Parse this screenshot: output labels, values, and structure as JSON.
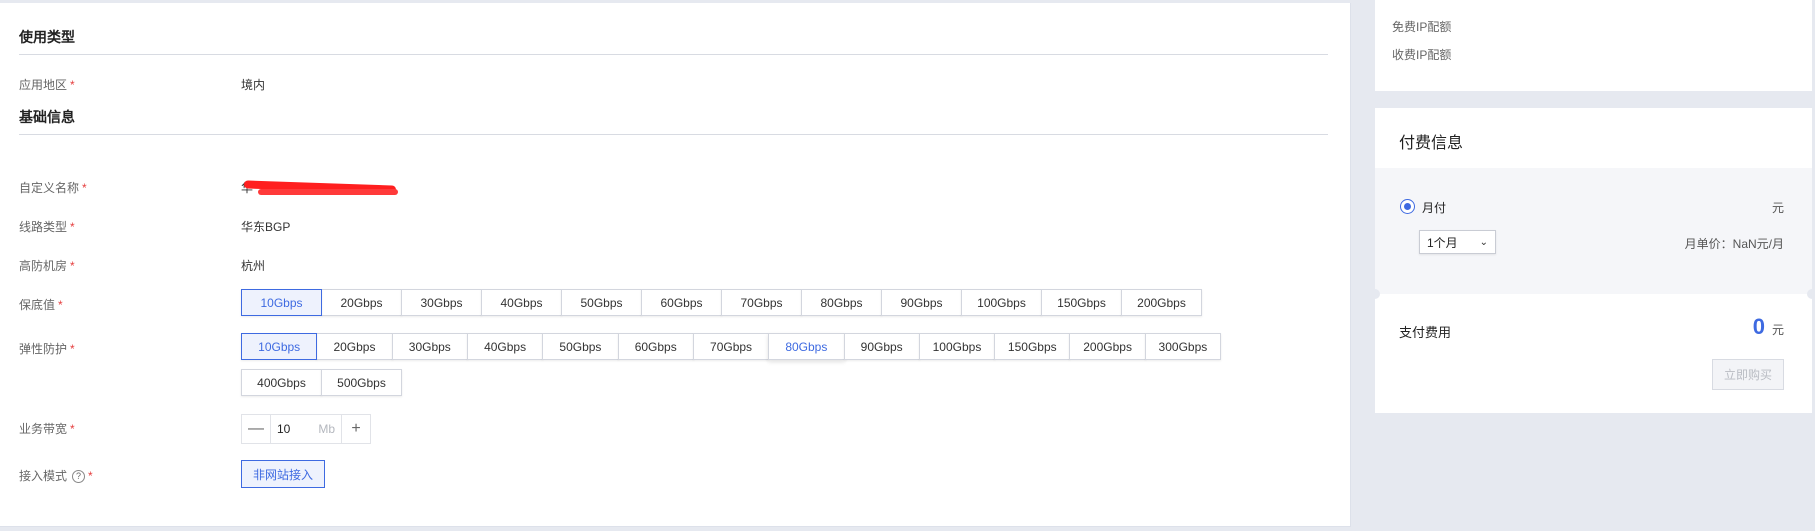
{
  "main": {
    "usage_section": {
      "title": "使用类型",
      "region_label": "应用地区",
      "region_value": "境内"
    },
    "basic_section": {
      "title": "基础信息",
      "custom_name_label": "自定义名称",
      "custom_name_value_visible_prefix": "华",
      "line_type_label": "线路类型",
      "line_type_value": "华东BGP",
      "room_label": "高防机房",
      "room_value": "杭州",
      "base_protect_label": "保底值",
      "base_protect_options": [
        "10Gbps",
        "20Gbps",
        "30Gbps",
        "40Gbps",
        "50Gbps",
        "60Gbps",
        "70Gbps",
        "80Gbps",
        "90Gbps",
        "100Gbps",
        "150Gbps",
        "200Gbps"
      ],
      "base_protect_selected": "10Gbps",
      "elastic_label": "弹性防护",
      "elastic_options_row1": [
        "10Gbps",
        "20Gbps",
        "30Gbps",
        "40Gbps",
        "50Gbps",
        "60Gbps",
        "70Gbps",
        "80Gbps",
        "90Gbps",
        "100Gbps",
        "150Gbps",
        "200Gbps",
        "300Gbps"
      ],
      "elastic_options_row2": [
        "400Gbps",
        "500Gbps"
      ],
      "elastic_selected": "10Gbps",
      "elastic_hovered": "80Gbps",
      "bandwidth_label": "业务带宽",
      "bandwidth_value": "10",
      "bandwidth_unit": "Mb",
      "minus_label": "—",
      "plus_label": "+",
      "access_label": "接入模式",
      "access_value": "非网站接入",
      "required_mark": "*",
      "help_glyph": "?"
    }
  },
  "quota": {
    "free_ip": "免费IP配额",
    "paid_ip": "收费IP配额"
  },
  "payment": {
    "title": "付费信息",
    "monthly_label": "月付",
    "yuan": "元",
    "duration": "1个月",
    "unit_price": "月单价：NaN元/月",
    "total_label": "支付费用",
    "total_value": "0",
    "total_currency": "元",
    "buy_button": "立即购买"
  },
  "colors": {
    "accent": "#3e6ae1",
    "required": "#e53e3e",
    "background": "#e6e9f0"
  }
}
